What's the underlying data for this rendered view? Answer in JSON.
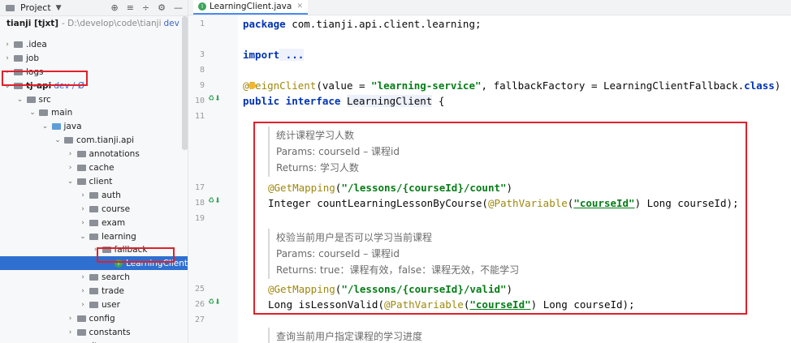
{
  "sidebar": {
    "title": "Project",
    "root": {
      "name": "tianji [tjxt]",
      "path": "- D:\\develop\\code\\tianji",
      "branch": "dev / Ø"
    },
    "items": [
      {
        "label": ".idea",
        "chev": ">",
        "indent": 0,
        "icon": "folder"
      },
      {
        "label": "job",
        "chev": ">",
        "indent": 0,
        "icon": "folder"
      },
      {
        "label": "logs",
        "chev": ">",
        "indent": 0,
        "icon": "folder"
      },
      {
        "label": "tj-api",
        "chev": "v",
        "indent": 0,
        "icon": "folder",
        "branch": "dev / Ø",
        "bold": true
      },
      {
        "label": "src",
        "chev": "v",
        "indent": 1,
        "icon": "folder"
      },
      {
        "label": "main",
        "chev": "v",
        "indent": 2,
        "icon": "folder"
      },
      {
        "label": "java",
        "chev": "v",
        "indent": 3,
        "icon": "folder-blue"
      },
      {
        "label": "com.tianji.api",
        "chev": "v",
        "indent": 4,
        "icon": "folder"
      },
      {
        "label": "annotations",
        "chev": ">",
        "indent": 5,
        "icon": "folder"
      },
      {
        "label": "cache",
        "chev": ">",
        "indent": 5,
        "icon": "folder"
      },
      {
        "label": "client",
        "chev": "v",
        "indent": 5,
        "icon": "folder"
      },
      {
        "label": "auth",
        "chev": ">",
        "indent": 6,
        "icon": "folder"
      },
      {
        "label": "course",
        "chev": ">",
        "indent": 6,
        "icon": "folder"
      },
      {
        "label": "exam",
        "chev": ">",
        "indent": 6,
        "icon": "folder"
      },
      {
        "label": "learning",
        "chev": "v",
        "indent": 6,
        "icon": "folder"
      },
      {
        "label": "fallback",
        "chev": ">",
        "indent": 7,
        "icon": "folder"
      },
      {
        "label": "LearningClient",
        "chev": "",
        "indent": 8,
        "icon": "class",
        "selected": true
      },
      {
        "label": "search",
        "chev": ">",
        "indent": 6,
        "icon": "folder"
      },
      {
        "label": "trade",
        "chev": ">",
        "indent": 6,
        "icon": "folder"
      },
      {
        "label": "user",
        "chev": ">",
        "indent": 6,
        "icon": "folder"
      },
      {
        "label": "config",
        "chev": ">",
        "indent": 5,
        "icon": "folder"
      },
      {
        "label": "constants",
        "chev": ">",
        "indent": 5,
        "icon": "folder"
      },
      {
        "label": "dto",
        "chev": ">",
        "indent": 5,
        "icon": "folder"
      }
    ]
  },
  "editor": {
    "tab": "LearningClient.java",
    "lines": {
      "l1": "1",
      "l3": "3",
      "l8": "8",
      "l9": "9",
      "l10": "10",
      "l11": "11",
      "l17": "17",
      "l18": "18",
      "l19": "19",
      "l25": "25",
      "l26": "26",
      "l27": "27"
    },
    "pkg_kw": "package",
    "pkg_name": " com.tianji.api.client.learning;",
    "import_kw": "import",
    "import_fold": " ...",
    "feign_ann": "@FeignClient",
    "feign_open": "(value = ",
    "feign_value": "\"learning-service\"",
    "feign_mid": ", fallbackFactory = LearningClientFallback.",
    "feign_class": "class",
    "feign_close": ")",
    "iface_kw": "public interface",
    "iface_name": "LearningClient",
    "iface_brace": " {",
    "doc1": [
      "统计课程学习人数",
      "Params: courseId – 课程id",
      "Returns: 学习人数"
    ],
    "m1_ann": "@GetMapping",
    "m1_path": "\"/lessons/{courseId}/count\"",
    "m1_sig_a": "Integer countLearningLessonByCourse(",
    "m1_pv": "@PathVariable",
    "m1_pv_arg": "\"courseId\"",
    "m1_sig_b": " Long courseId);",
    "doc2": [
      "校验当前用户是否可以学习当前课程",
      "Params: courseId – 课程id",
      "Returns: true：课程有效，false：课程无效，不能学习"
    ],
    "m2_ann": "@GetMapping",
    "m2_path": "\"/lessons/{courseId}/valid\"",
    "m2_sig_a": "Long isLessonValid(",
    "m2_pv": "@PathVariable",
    "m2_pv_arg": "\"courseId\"",
    "m2_sig_b": " Long courseId);",
    "doc3": "查询当前用户指定课程的学习进度"
  },
  "colors": {
    "accent": "#2f6fd0",
    "highlight_box": "#e0202a",
    "keyword": "#0033b3",
    "string": "#067d17",
    "annotation": "#9e880d"
  }
}
